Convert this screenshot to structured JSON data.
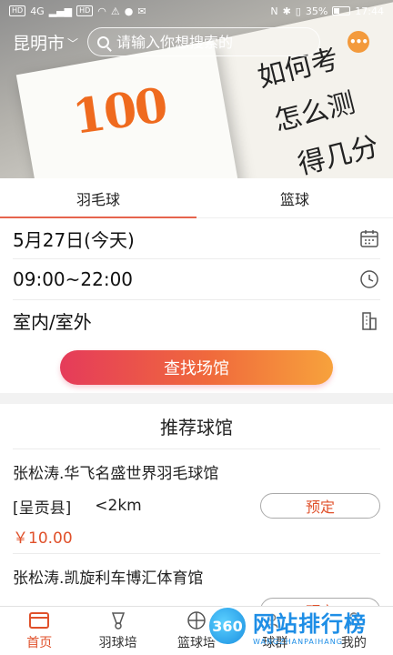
{
  "status_bar": {
    "network_chips": [
      "HD",
      "HD"
    ],
    "signal_text": "4G",
    "battery_percent": "35%",
    "time": "17:44"
  },
  "header": {
    "city": "昆明市",
    "search_placeholder": "请输入你想搜索的",
    "more_icon": "more-dots-icon"
  },
  "hero": {
    "score_text": "100",
    "handwriting_lines": [
      "如何考",
      "怎么测",
      "得几分"
    ]
  },
  "tabs": [
    {
      "label": "羽毛球",
      "active": true
    },
    {
      "label": "篮球",
      "active": false
    }
  ],
  "filters": {
    "date": "5月27日(今天)",
    "time_range": "09:00~22:00",
    "venue_type": "室内/室外"
  },
  "find_button": "查找场馆",
  "recommend": {
    "title": "推荐球馆",
    "venues": [
      {
        "name": "张松涛.华飞名盛世界羽毛球馆",
        "district": "[呈贡县]",
        "distance": "<2km",
        "book_label": "预定",
        "price": "￥10.00"
      },
      {
        "name": "张松涛.凯旋利车博汇体育馆",
        "district": "",
        "distance": "",
        "book_label": "预定",
        "price": ""
      }
    ]
  },
  "bottom_nav": [
    {
      "label": "首页",
      "icon": "home-icon",
      "active": true
    },
    {
      "label": "羽球培",
      "icon": "shuttlecock-icon",
      "active": false
    },
    {
      "label": "篮球培",
      "icon": "basketball-icon",
      "active": false
    },
    {
      "label": "球群",
      "icon": "group-icon",
      "active": false
    },
    {
      "label": "我的",
      "icon": "profile-icon",
      "active": false
    }
  ],
  "watermark": {
    "logo_text": "360",
    "main": "网站排行榜",
    "sub": "WANGZHANPAIHANG"
  },
  "colors": {
    "accent": "#e0512b",
    "tab_underline": "#e6644d",
    "button_gradient_start": "#e53b5a",
    "button_gradient_end": "#f7a23c"
  }
}
